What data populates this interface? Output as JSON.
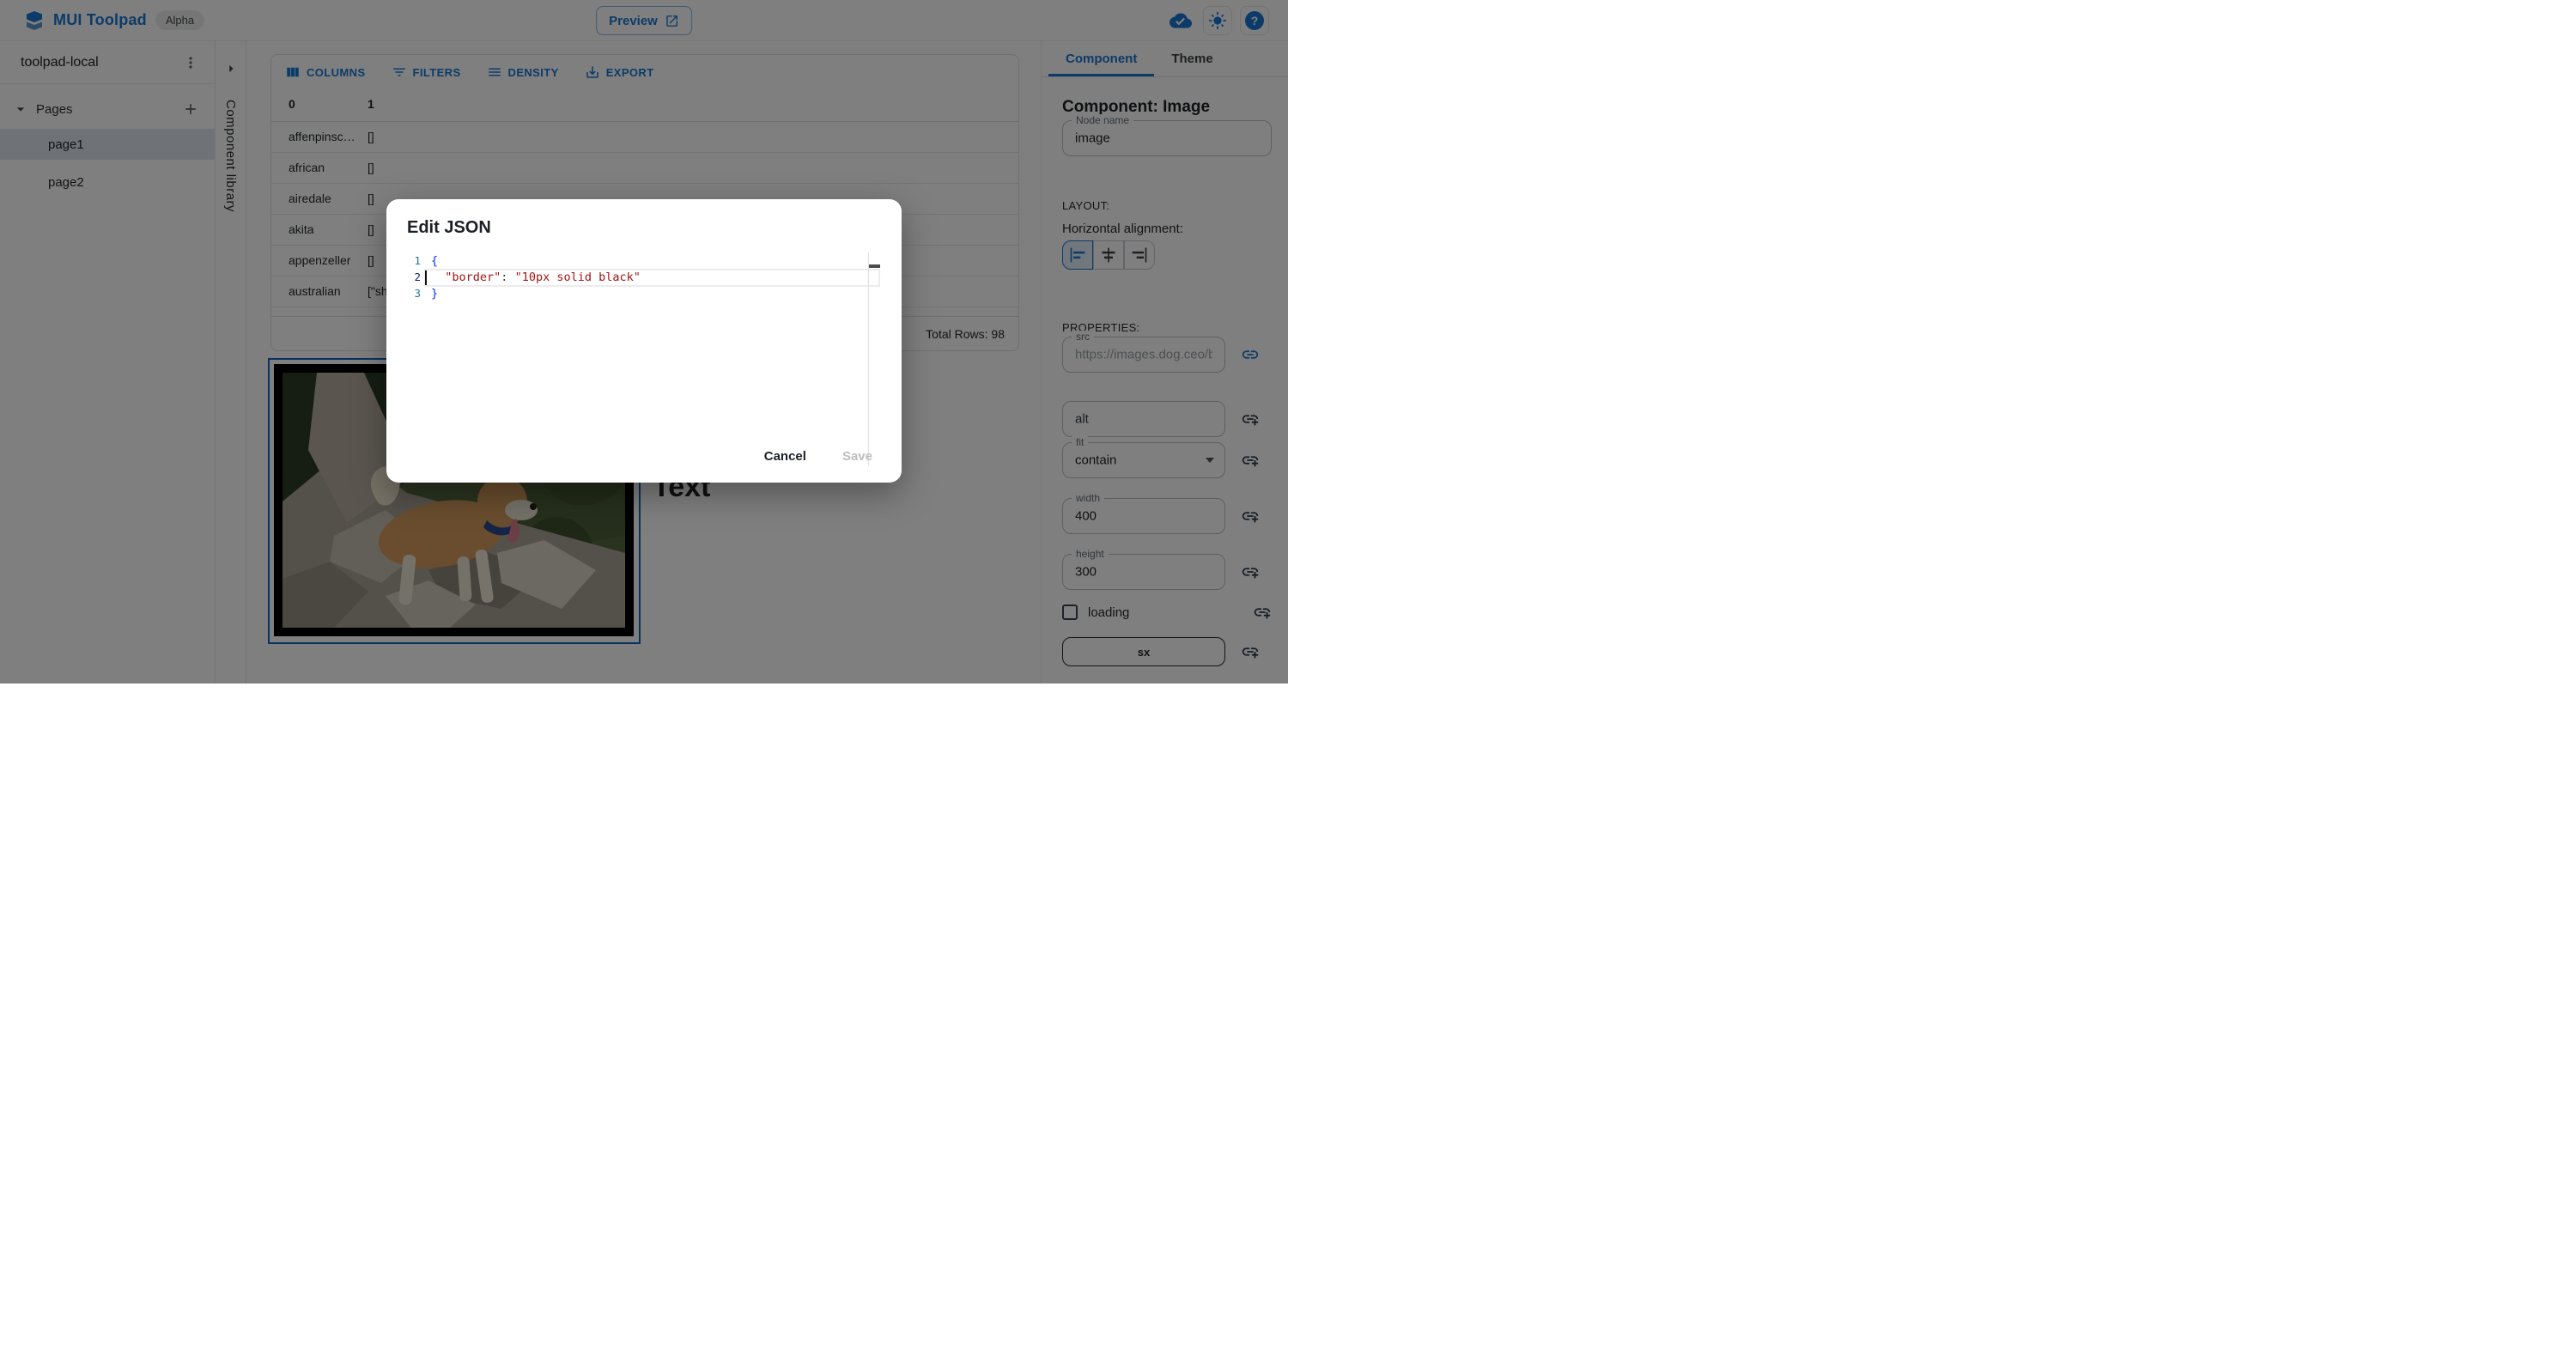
{
  "colors": {
    "accent": "#1976d2",
    "selection_outline": "#1565c0",
    "backdrop": "rgba(0,0,0,0.5)",
    "json_string": "#a31515",
    "json_brace": "#0431fa",
    "line_number": "#237893",
    "line_number_active": "#0b216f"
  },
  "header": {
    "app_title": "MUI Toolpad",
    "badge": "Alpha",
    "preview_label": "Preview"
  },
  "sidebar": {
    "project_name": "toolpad-local",
    "section_pages": "Pages",
    "pages": [
      {
        "label": "page1"
      },
      {
        "label": "page2"
      }
    ]
  },
  "component_library": {
    "label": "Component library"
  },
  "grid": {
    "toolbar": {
      "columns": "COLUMNS",
      "filters": "FILTERS",
      "density": "DENSITY",
      "export": "EXPORT"
    },
    "columns": {
      "c0": "0",
      "c1": "1"
    },
    "rows": [
      {
        "c0": "affenpinsc…",
        "c1": "[]"
      },
      {
        "c0": "african",
        "c1": "[]"
      },
      {
        "c0": "airedale",
        "c1": "[]"
      },
      {
        "c0": "akita",
        "c1": "[]"
      },
      {
        "c0": "appenzeller",
        "c1": "[]"
      },
      {
        "c0": "australian",
        "c1": "[\"sh"
      }
    ],
    "footer": "Total Rows: 98"
  },
  "canvas": {
    "text_component": "Text"
  },
  "modal": {
    "title": "Edit JSON",
    "num1": "1",
    "num2": "2",
    "num3": "3",
    "brace_open": "{",
    "brace_close": "}",
    "key": "\"border\"",
    "colon": ": ",
    "value": "\"10px solid black\"",
    "cancel": "Cancel",
    "save": "Save"
  },
  "inspector": {
    "tab_component": "Component",
    "tab_theme": "Theme",
    "heading": "Component: Image",
    "node_name": {
      "label": "Node name",
      "value": "image"
    },
    "layout_label": "LAYOUT:",
    "alignment_label": "Horizontal alignment:",
    "properties_label": "PROPERTIES:",
    "src": {
      "label": "src",
      "value": "https://images.dog.ceo/b"
    },
    "alt": {
      "label": "alt"
    },
    "fit": {
      "label": "fit",
      "value": "contain"
    },
    "width": {
      "label": "width",
      "value": "400"
    },
    "height": {
      "label": "height",
      "value": "300"
    },
    "loading_label": "loading",
    "sx_label": "sx"
  }
}
